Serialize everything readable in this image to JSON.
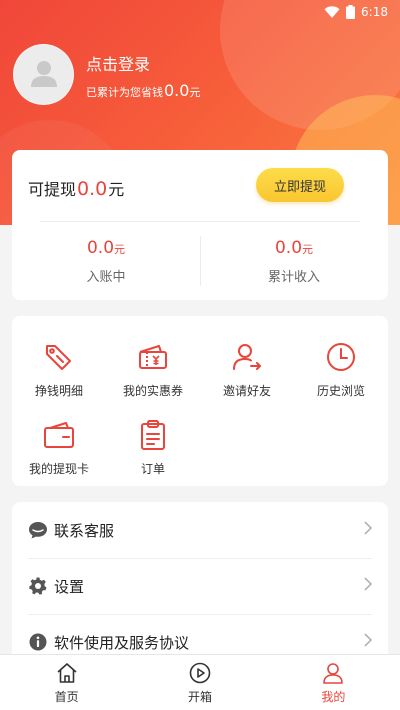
{
  "status_bar": {
    "time": "6:18"
  },
  "profile": {
    "login_label": "点击登录",
    "saved_prefix": "已累计为您省钱",
    "saved_amount": "0.0",
    "saved_unit": "元"
  },
  "withdraw": {
    "label": "可提现",
    "amount": "0.0",
    "unit": "元",
    "button_label": "立即提现",
    "stats": [
      {
        "value": "0.0",
        "unit": "元",
        "label": "入账中"
      },
      {
        "value": "0.0",
        "unit": "元",
        "label": "累计收入"
      }
    ]
  },
  "grid": {
    "items": [
      {
        "label": "挣钱明细",
        "icon": "tag-icon"
      },
      {
        "label": "我的实惠券",
        "icon": "coupon-icon"
      },
      {
        "label": "邀请好友",
        "icon": "invite-user-icon"
      },
      {
        "label": "历史浏览",
        "icon": "clock-icon"
      },
      {
        "label": "我的提现卡",
        "icon": "wallet-card-icon"
      },
      {
        "label": "订单",
        "icon": "clipboard-icon"
      }
    ]
  },
  "menu": {
    "items": [
      {
        "label": "联系客服",
        "icon": "chat-bubble-icon"
      },
      {
        "label": "设置",
        "icon": "gear-icon"
      },
      {
        "label": "软件使用及服务协议",
        "icon": "info-icon"
      }
    ]
  },
  "bottom_nav": {
    "items": [
      {
        "label": "首页",
        "icon": "home-icon",
        "active": false
      },
      {
        "label": "开箱",
        "icon": "play-circle-icon",
        "active": false
      },
      {
        "label": "我的",
        "icon": "user-icon",
        "active": true
      }
    ],
    "active_color": "#e8453c"
  },
  "colors": {
    "accent": "#e8453c",
    "button_yellow": "#fbd13c",
    "header_start": "#f0463a",
    "header_end": "#fb7d40"
  }
}
